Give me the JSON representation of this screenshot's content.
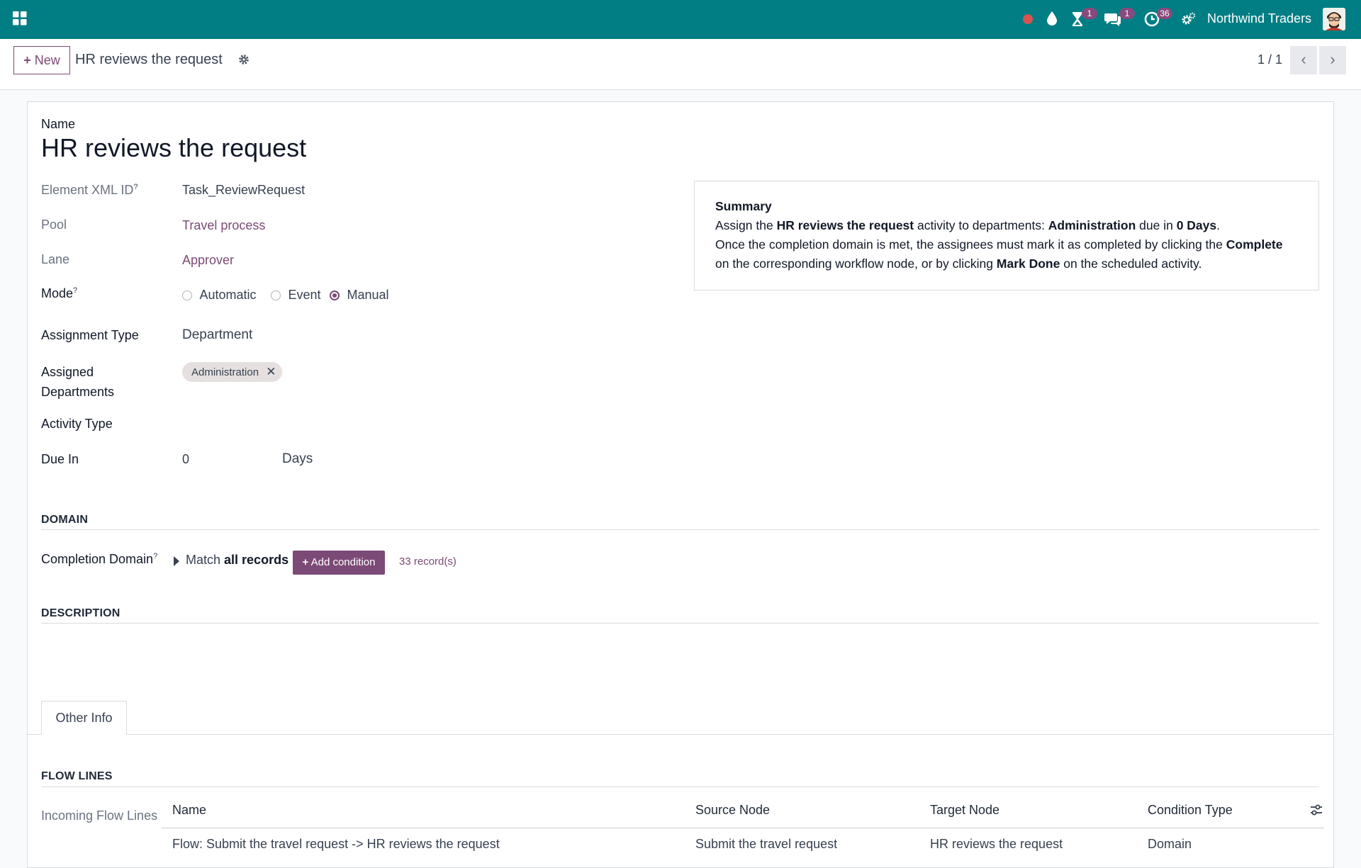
{
  "navbar": {
    "company": "Northwind Traders",
    "activity_badge": "1",
    "messages_badge": "1",
    "clock_badge": "36",
    "colors": {
      "navbar": "#017e84",
      "brand": "#7c4a76",
      "badge": "#874a7d"
    }
  },
  "control_panel": {
    "new_label": "New",
    "breadcrumb": "HR reviews the request",
    "pager": "1 / 1"
  },
  "form": {
    "name_label": "Name",
    "title": "HR reviews the request",
    "xml_id_label": "Element XML ID",
    "xml_id_value": "Task_ReviewRequest",
    "pool_label": "Pool",
    "pool_value": "Travel process",
    "lane_label": "Lane",
    "lane_value": "Approver",
    "mode_label": "Mode",
    "mode_options": [
      "Automatic",
      "Event",
      "Manual"
    ],
    "mode_selected": "Manual",
    "assignment_type_label": "Assignment Type",
    "assignment_type_value": "Department",
    "assigned_departments_label_1": "Assigned",
    "assigned_departments_label_2": "Departments",
    "department_tag": "Administration",
    "activity_type_label": "Activity Type",
    "due_in_label": "Due In",
    "due_in_value": "0",
    "due_in_unit": "Days",
    "help_mark": "?"
  },
  "summary": {
    "title": "Summary",
    "l1_a": "Assign the ",
    "l1_b": "HR reviews the request",
    "l1_c": " activity to departments: ",
    "l1_d": "Administration",
    "l1_e": " due in ",
    "l1_f": "0 Days",
    "l1_g": ".",
    "l2_a": "Once the completion domain is met, the assignees must mark it as completed by clicking the ",
    "l2_b": "Complete",
    "l3_a": "on the corresponding workflow node, or by clicking ",
    "l3_b": "Mark Done",
    "l3_c": " on the scheduled activity."
  },
  "domain": {
    "section": "DOMAIN",
    "completion_label": "Completion Domain",
    "match_prefix": "Match ",
    "match_bold": "all records",
    "add_condition": "Add condition",
    "records": "33 record(s)"
  },
  "description": {
    "section": "DESCRIPTION"
  },
  "tabs": {
    "other_info": "Other Info"
  },
  "flow_lines": {
    "section": "FLOW LINES",
    "incoming_label": "Incoming Flow Lines",
    "columns": [
      "Name",
      "Source Node",
      "Target Node",
      "Condition Type"
    ],
    "rows": [
      [
        "Flow: Submit the travel request -> HR reviews the request",
        "Submit the travel request",
        "HR reviews the request",
        "Domain"
      ]
    ]
  }
}
